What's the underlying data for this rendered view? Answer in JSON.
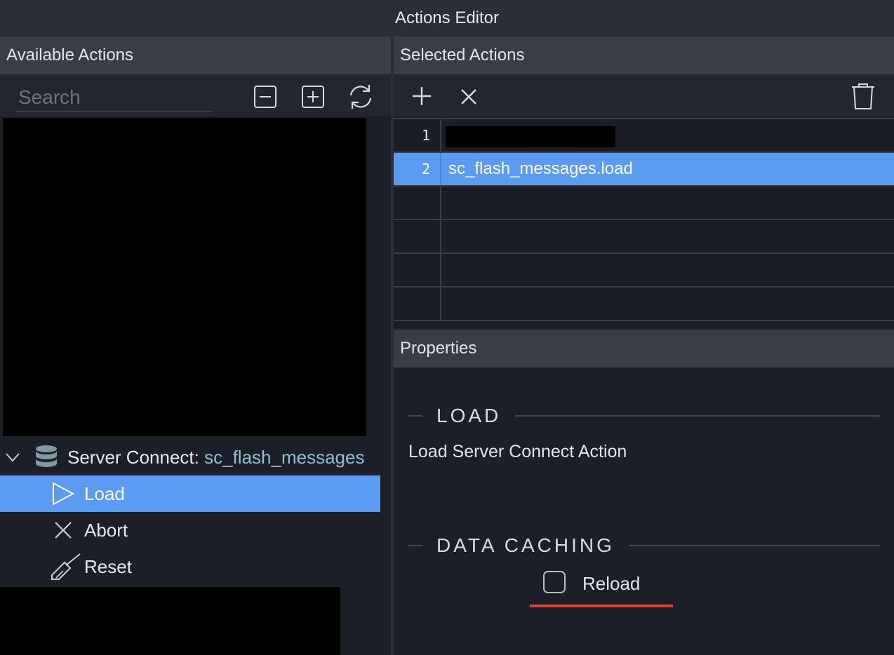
{
  "window": {
    "title": "Actions Editor"
  },
  "available": {
    "header": "Available Actions",
    "search_placeholder": "Search",
    "tree": {
      "group_label": "Server Connect:",
      "group_name": "sc_flash_messages",
      "items": [
        {
          "label": "Load",
          "icon": "play-icon",
          "selected": true
        },
        {
          "label": "Abort",
          "icon": "close-icon",
          "selected": false
        },
        {
          "label": "Reset",
          "icon": "broom-icon",
          "selected": false
        }
      ]
    }
  },
  "selected": {
    "header": "Selected Actions",
    "rows": [
      {
        "num": "1",
        "value": ""
      },
      {
        "num": "2",
        "value": "sc_flash_messages.load"
      }
    ]
  },
  "properties": {
    "header": "Properties",
    "section_load": "LOAD",
    "description": "Load Server Connect Action",
    "section_caching": "DATA CACHING",
    "reload_label": "Reload"
  },
  "colors": {
    "selection": "#5b9bf2",
    "accent_underline": "#e5402f",
    "group_name": "#8fc0cc"
  }
}
